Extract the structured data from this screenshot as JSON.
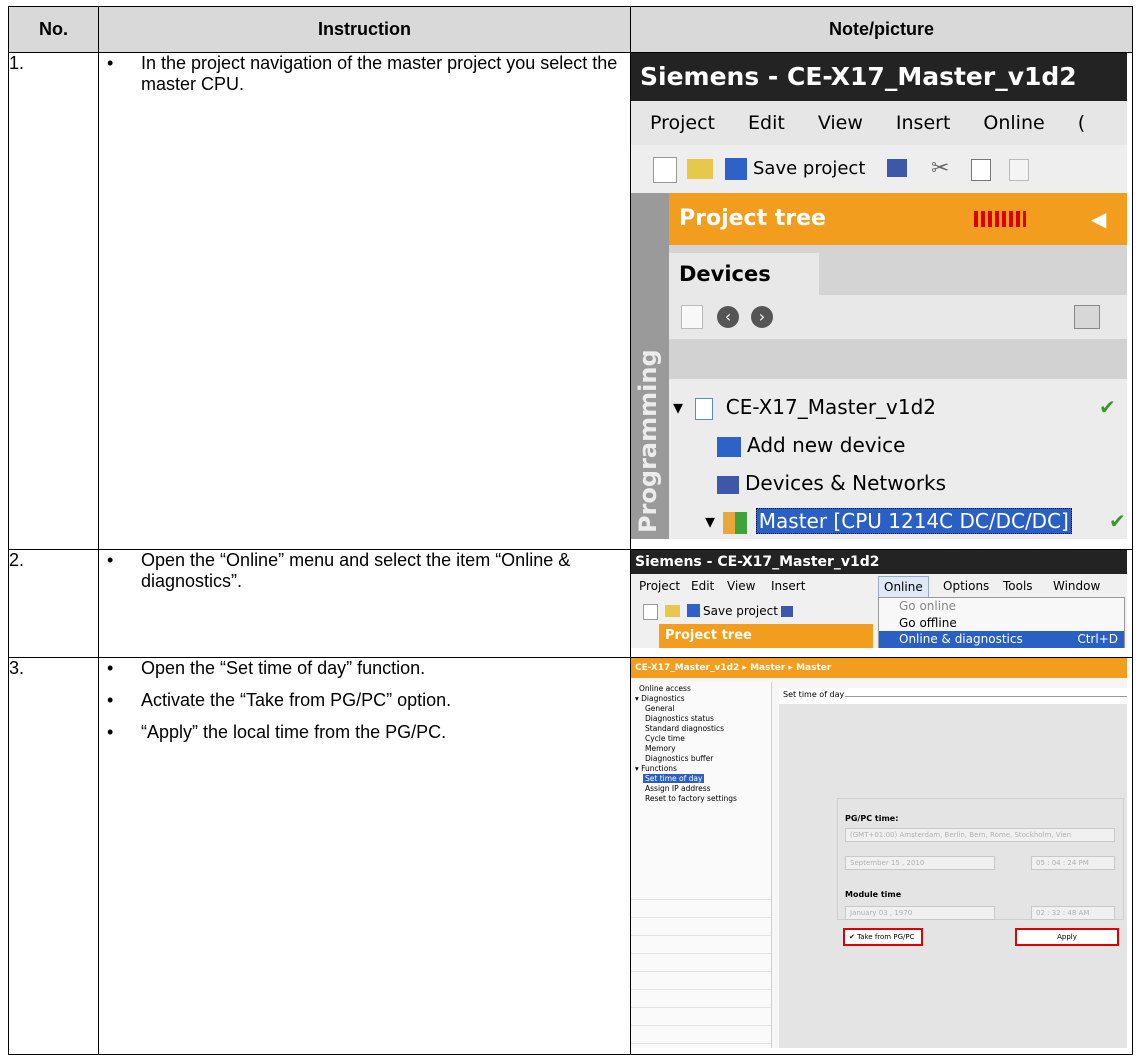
{
  "table": {
    "headers": {
      "no": "No.",
      "instruction": "Instruction",
      "note": "Note/picture"
    },
    "rows": [
      {
        "no": "1.",
        "bullets": [
          "In the project navigation of the master project you select the master CPU."
        ]
      },
      {
        "no": "2.",
        "bullets": [
          "Open the “Online” menu and select the item “Online & diagnostics”."
        ]
      },
      {
        "no": "3.",
        "bullets": [
          "Open the “Set time of day” function.",
          "Activate the “Take from PG/PC” option.",
          "“Apply” the local time from the PG/PC."
        ]
      }
    ]
  },
  "shot1": {
    "title": "Siemens  -  CE-X17_Master_v1d2",
    "menu": [
      "Project",
      "Edit",
      "View",
      "Insert",
      "Online",
      "("
    ],
    "save_label": "Save project",
    "project_tree": "Project tree",
    "devices_tab": "Devices",
    "sidebar_label": "Programming",
    "tree": {
      "project": "CE-X17_Master_v1d2",
      "add_device": "Add new device",
      "networks": "Devices & Networks",
      "master": "Master [CPU 1214C DC/DC/DC]"
    }
  },
  "shot2": {
    "title": "Siemens  -  CE-X17_Master_v1d2",
    "menu": [
      "Project",
      "Edit",
      "View",
      "Insert",
      "Online",
      "Options",
      "Tools",
      "Window"
    ],
    "save_label": "Save project",
    "project_tree": "Project tree",
    "dropdown": [
      "Go online",
      "Go offline",
      "Online & diagnostics"
    ],
    "shortcut": "Ctrl+D"
  },
  "shot3": {
    "breadcrumb": "CE-X17_Master_v1d2  ▸  Master  ▸  Master",
    "nav": [
      "Online access",
      "▾ Diagnostics",
      "General",
      "Diagnostics status",
      "Standard diagnostics",
      "Cycle time",
      "Memory",
      "Diagnostics buffer",
      "▾ Functions",
      "Set time of day",
      "Assign IP address",
      "Reset to factory settings"
    ],
    "panel_title": "Set time of day",
    "pgpc_label": "PG/PC time:",
    "timezone": "(GMT+01:00) Amsterdam, Berlin, Bern, Rome, Stockholm, Vien",
    "pgpc_date": "September 15 , 2010",
    "pgpc_time": "05 : 04 : 24  PM",
    "module_label": "Module time",
    "module_date": "January  03 , 1970",
    "module_time": "02 : 32 : 48  AM",
    "take_label": "Take from PG/PC",
    "apply_label": "Apply"
  }
}
